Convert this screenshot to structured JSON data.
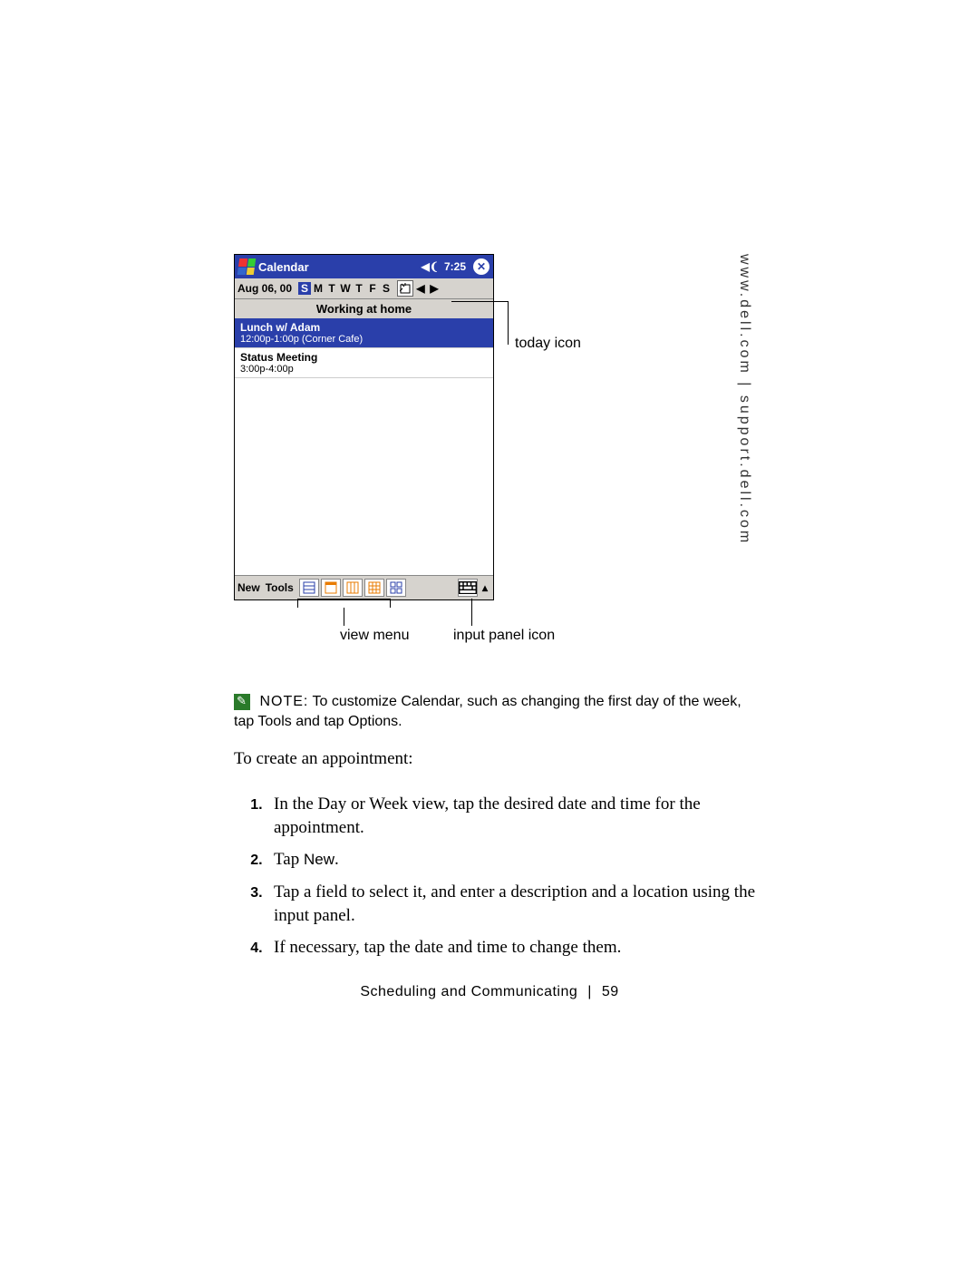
{
  "side_text": "www.dell.com | support.dell.com",
  "device": {
    "title": "Calendar",
    "clock": "7:25",
    "date_label": "Aug 06, 00",
    "days": [
      "S",
      "M",
      "T",
      "W",
      "T",
      "F",
      "S"
    ],
    "selected_day_index": 0,
    "banner": "Working at home",
    "appointments": [
      {
        "title": "Lunch w/ Adam",
        "sub": "12:00p-1:00p (Corner Cafe)",
        "selected": true
      },
      {
        "title": "Status Meeting",
        "sub": "3:00p-4:00p",
        "selected": false
      }
    ],
    "menu": {
      "new": "New",
      "tools": "Tools"
    }
  },
  "callouts": {
    "today": "today icon",
    "view_menu": "view menu",
    "input_panel": "input panel icon"
  },
  "note": {
    "prefix": "NOTE:",
    "text": " To customize Calendar, such as changing the first day of the week, tap Tools and tap Options."
  },
  "intro": "To create an appointment:",
  "steps": [
    {
      "pre": "In the Day or Week view, tap the desired date and time for the appointment."
    },
    {
      "pre": "Tap ",
      "sans": "New",
      "post": "."
    },
    {
      "pre": "Tap a field to select it, and enter a description and a location using the input panel."
    },
    {
      "pre": "If necessary, tap the date and time to change them."
    }
  ],
  "footer": {
    "section": "Scheduling and Communicating",
    "page": "59"
  }
}
